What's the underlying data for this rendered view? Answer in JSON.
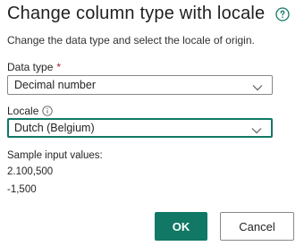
{
  "dialog": {
    "title": "Change column type with locale",
    "help_icon": "question-circle-icon",
    "subtitle": "Change the data type and select the locale of origin."
  },
  "data_type": {
    "label": "Data type",
    "required_marker": "*",
    "value": "Decimal number",
    "chevron_icon": "chevron-down-icon"
  },
  "locale": {
    "label": "Locale",
    "info_icon": "info-circle-icon",
    "value": "Dutch (Belgium)",
    "chevron_icon": "chevron-down-icon"
  },
  "samples": {
    "label": "Sample input values:",
    "values": [
      "2.100,500",
      "-1,500"
    ]
  },
  "buttons": {
    "ok_label": "OK",
    "cancel_label": "Cancel"
  },
  "colors": {
    "accent": "#117865",
    "required": "#a4262c",
    "border": "#8a8886",
    "text": "#252423"
  }
}
